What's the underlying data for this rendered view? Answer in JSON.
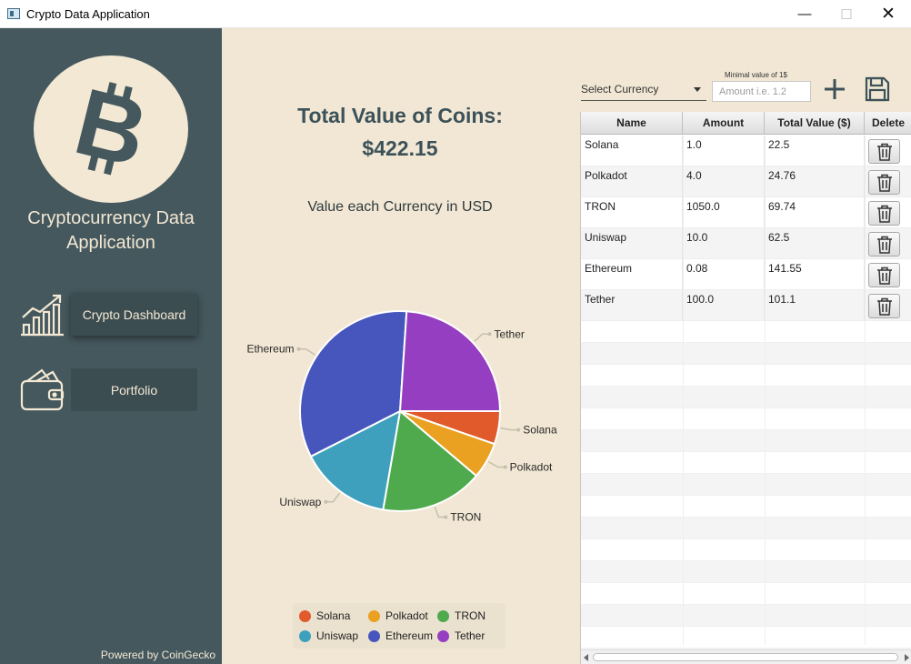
{
  "window": {
    "title": "Crypto Data Application",
    "controls": {
      "minimize": "—",
      "maximize": "☐",
      "close": "✕"
    }
  },
  "sidebar": {
    "app_name_line1": "Cryptocurrency Data",
    "app_name_line2": "Application",
    "logo_icon": "bitcoin-icon",
    "nav": [
      {
        "label": "Crypto Dashboard",
        "icon": "chart-growth-icon",
        "active": true
      },
      {
        "label": "Portfolio",
        "icon": "wallet-icon",
        "active": false
      }
    ],
    "footer": "Powered by CoinGecko"
  },
  "summary": {
    "title": "Total Value of Coins:",
    "value": "$422.15"
  },
  "chart_title": "Value each Currency in USD",
  "controls": {
    "select_label": "Select Currency",
    "min_label": "Minimal value of 1$",
    "amount_placeholder": "Amount i.e. 1.2",
    "add_icon": "plus-icon",
    "save_icon": "save-icon"
  },
  "table": {
    "columns": [
      "Name",
      "Amount",
      "Total Value ($)",
      "Delete"
    ],
    "rows": [
      {
        "name": "Solana",
        "amount": "1.0",
        "total": "22.5"
      },
      {
        "name": "Polkadot",
        "amount": "4.0",
        "total": "24.76"
      },
      {
        "name": "TRON",
        "amount": "1050.0",
        "total": "69.74"
      },
      {
        "name": "Uniswap",
        "amount": "10.0",
        "total": "62.5"
      },
      {
        "name": "Ethereum",
        "amount": "0.08",
        "total": "141.55"
      },
      {
        "name": "Tether",
        "amount": "100.0",
        "total": "101.1"
      }
    ],
    "delete_icon": "trash-icon"
  },
  "chart_data": {
    "type": "pie",
    "title": "Value each Currency in USD",
    "legend_placement": "bottom",
    "slices": [
      {
        "label": "Solana",
        "value": 22.5,
        "color": "#e05a2b"
      },
      {
        "label": "Polkadot",
        "value": 24.76,
        "color": "#eaa020"
      },
      {
        "label": "TRON",
        "value": 69.74,
        "color": "#4faa4d"
      },
      {
        "label": "Uniswap",
        "value": 62.5,
        "color": "#3ea0bc"
      },
      {
        "label": "Ethereum",
        "value": 141.55,
        "color": "#4756bd"
      },
      {
        "label": "Tether",
        "value": 101.1,
        "color": "#963ec1"
      }
    ]
  }
}
